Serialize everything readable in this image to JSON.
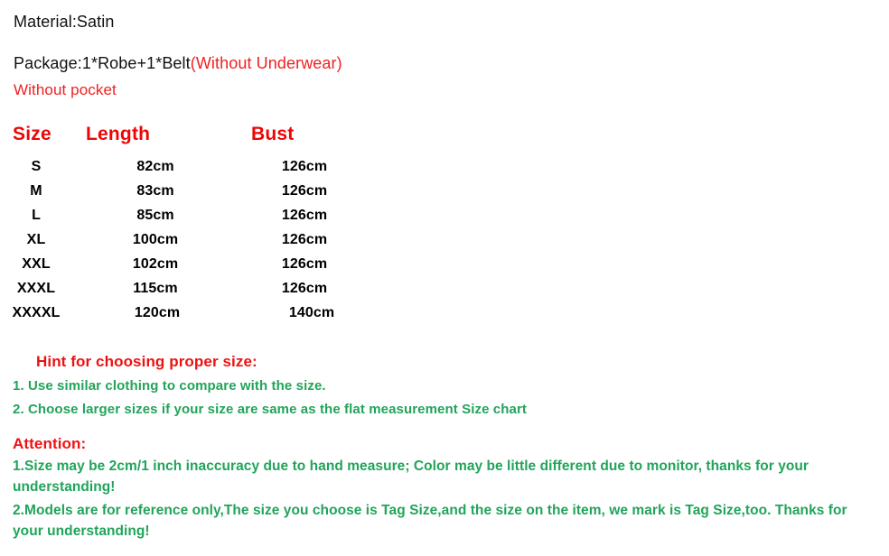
{
  "document": {
    "title": "Product Size Chart",
    "background_color": "#ffffff",
    "red": "#ee1111",
    "green": "#21a45a",
    "black": "#000000"
  },
  "intro": {
    "material_line": "Material:Satin",
    "package_line_black": "Package:1*Robe+1*Belt",
    "package_line_red": "(Without Underwear)",
    "no_pocket_line": "Without pocket"
  },
  "size_chart": {
    "headers": [
      "Size",
      "Length",
      "Bust"
    ],
    "rows": [
      {
        "size": "S",
        "length": "82cm",
        "bust": "126cm"
      },
      {
        "size": "M",
        "length": "83cm",
        "bust": "126cm"
      },
      {
        "size": "L",
        "length": "85cm",
        "bust": "126cm"
      },
      {
        "size": "XL",
        "length": "100cm",
        "bust": "126cm"
      },
      {
        "size": "XXL",
        "length": "102cm",
        "bust": "126cm"
      },
      {
        "size": "XXXL",
        "length": "115cm",
        "bust": "126cm"
      },
      {
        "size": "XXXXL",
        "length": "120cm",
        "bust": "140cm"
      }
    ]
  },
  "hint": {
    "title": "Hint for choosing proper size:",
    "items": [
      "1. Use similar clothing to compare with the size.",
      "2. Choose larger sizes if your size are same as the flat measurement Size chart"
    ]
  },
  "attention": {
    "title": "Attention:",
    "items": [
      "1.Size may be 2cm/1 inch inaccuracy due to hand measure; Color may be little different   due to monitor, thanks for your understanding!",
      "2.Models are for reference only,The size you choose is Tag Size,and the size on the item,  we mark is Tag Size,too. Thanks for your understanding!"
    ]
  }
}
